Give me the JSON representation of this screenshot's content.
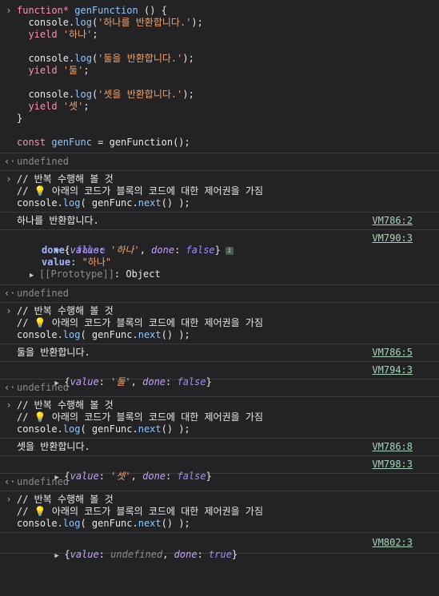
{
  "code": {
    "l1": {
      "kw": "function*",
      "name": "genFunction",
      "rest": " () {"
    },
    "l2": {
      "pre": "console.",
      "fn": "log",
      "open": "(",
      "str": "'하나를 반환합니다.'",
      "close": ");"
    },
    "l3": {
      "kw": "yield",
      "str": "'하나'",
      "end": ";"
    },
    "l4": {
      "pre": "console.",
      "fn": "log",
      "open": "(",
      "str": "'둘을 반환합니다.'",
      "close": ");"
    },
    "l5": {
      "kw": "yield",
      "str": "'둘'",
      "end": ";"
    },
    "l6": {
      "pre": "console.",
      "fn": "log",
      "open": "(",
      "str": "'셋을 반환합니다.'",
      "close": ");"
    },
    "l7": {
      "kw": "yield",
      "str": "'셋'",
      "end": ";"
    },
    "l8": "}",
    "l9": {
      "kw": "const",
      "name": "genFunc",
      "rest": " = genFunction();"
    }
  },
  "undefined_text": "undefined",
  "input_block": {
    "comment1": "// 반복 수행해 볼 것",
    "comment2_pre": "// ",
    "bulb": "💡",
    "comment2_post": " 아래의 코드가 블록의 코드에 대한 제어권을 가짐",
    "call_pre": "console.",
    "call_fn": "log",
    "call_mid": "( genFunc.",
    "call_fn2": "next",
    "call_end": "() );"
  },
  "outputs": [
    {
      "text": "하나를 반환합니다.",
      "source": "VM786:2"
    },
    {
      "source": "VM790:3",
      "prop_value": "value",
      "value": "'하나'",
      "prop_done": "done",
      "done": "false",
      "expanded": {
        "done_key": "done",
        "done_val": "false",
        "value_key": "value",
        "value_val": "\"하나\"",
        "proto": "[[Prototype]]",
        "proto_val": "Object"
      },
      "info": "i"
    },
    {
      "text": "둘을 반환합니다.",
      "source": "VM786:5"
    },
    {
      "source": "VM794:3",
      "prop_value": "value",
      "value": "'둘'",
      "prop_done": "done",
      "done": "false"
    },
    {
      "text": "셋을 반환합니다.",
      "source": "VM786:8"
    },
    {
      "source": "VM798:3",
      "prop_value": "value",
      "value": "'셋'",
      "prop_done": "done",
      "done": "false"
    },
    {
      "source": "VM802:3",
      "prop_value": "value",
      "value": "undefined",
      "prop_done": "done",
      "done": "true"
    }
  ],
  "icons": {
    "input": "chevron-right-icon",
    "return": "return-arrow-icon",
    "expand": "triangle-icon"
  }
}
